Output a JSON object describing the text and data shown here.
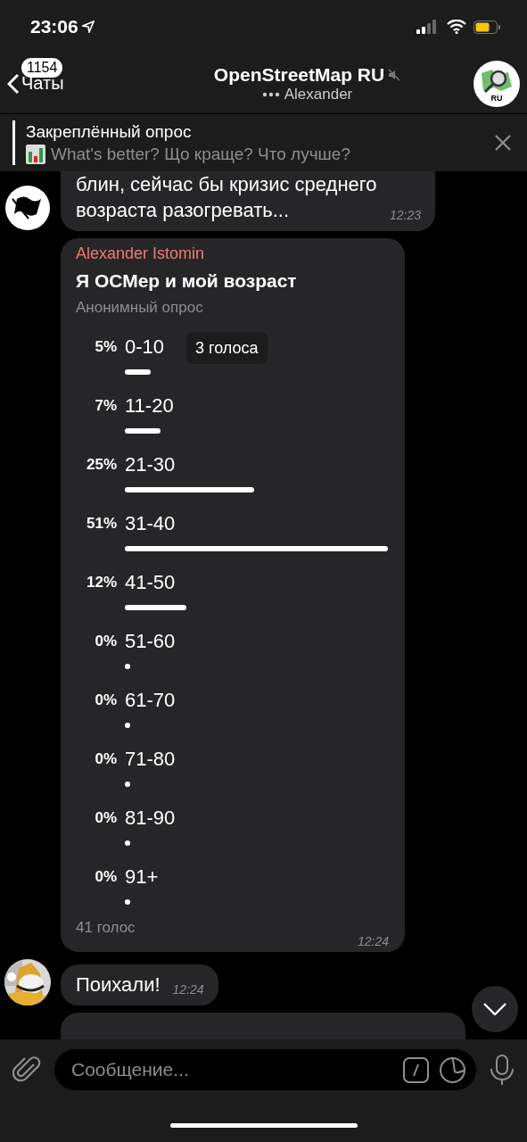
{
  "status_bar": {
    "time": "23:06"
  },
  "header": {
    "back_label": "Чаты",
    "unread_badge": "1154",
    "title": "OpenStreetMap RU",
    "muted": true,
    "typing": "Alexander",
    "avatar_label": "RU"
  },
  "pinned": {
    "heading": "Закреплённый опрос",
    "text": "What's better? Що краще? Что лучше?"
  },
  "messages": [
    {
      "kind": "text",
      "avatar": {
        "kind": "flag"
      },
      "text": "блин, сейчас бы кризис среднего возраста разогревать...",
      "time": "12:23"
    },
    {
      "kind": "poll",
      "sender": "Alexander Istomin",
      "question": "Я ОСМер и мой возраст",
      "poll_type": "Анонимный опрос",
      "tooltip": "3 голоса",
      "total": "41 голос",
      "time": "12:24",
      "options": [
        {
          "percent": "5%",
          "label": "0-10"
        },
        {
          "percent": "7%",
          "label": "11-20"
        },
        {
          "percent": "25%",
          "label": "21-30"
        },
        {
          "percent": "51%",
          "label": "31-40"
        },
        {
          "percent": "12%",
          "label": "41-50"
        },
        {
          "percent": "0%",
          "label": "51-60"
        },
        {
          "percent": "0%",
          "label": "61-70"
        },
        {
          "percent": "0%",
          "label": "71-80"
        },
        {
          "percent": "0%",
          "label": "81-90"
        },
        {
          "percent": "0%",
          "label": "91+"
        }
      ]
    },
    {
      "kind": "text",
      "text": "Поихали!",
      "time": "12:24"
    },
    {
      "kind": "cut"
    }
  ],
  "input": {
    "placeholder": "Сообщение..."
  }
}
